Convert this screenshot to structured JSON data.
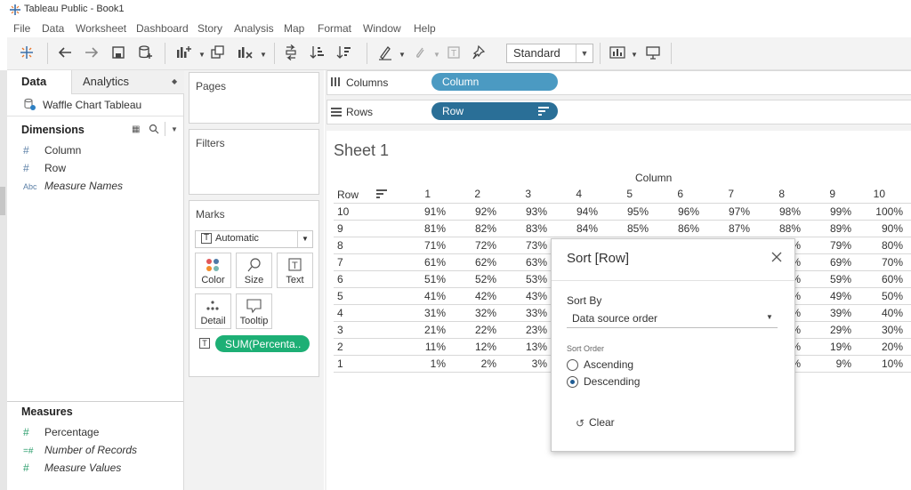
{
  "window": {
    "title": "Tableau Public - Book1"
  },
  "menu": [
    "File",
    "Data",
    "Worksheet",
    "Dashboard",
    "Story",
    "Analysis",
    "Map",
    "Format",
    "Window",
    "Help"
  ],
  "toolbar": {
    "fit_select": "Standard"
  },
  "data_pane": {
    "tabs": [
      "Data",
      "Analytics"
    ],
    "datasource": "Waffle Chart Tableau",
    "dimensions_header": "Dimensions",
    "dimensions": [
      {
        "icon": "#",
        "label": "Column"
      },
      {
        "icon": "#",
        "label": "Row"
      },
      {
        "icon": "Abc",
        "label": "Measure Names"
      }
    ],
    "measures_header": "Measures",
    "measures": [
      {
        "icon": "#",
        "label": "Percentage"
      },
      {
        "icon": "=#",
        "label": "Number of Records"
      },
      {
        "icon": "#",
        "label": "Measure Values"
      }
    ]
  },
  "cards": {
    "pages": "Pages",
    "filters": "Filters",
    "marks": "Marks",
    "mark_type": "Automatic",
    "mark_buttons": [
      "Color",
      "Size",
      "Text",
      "Detail",
      "Tooltip"
    ],
    "text_pill": "SUM(Percenta.."
  },
  "shelves": {
    "columns_label": "Columns",
    "columns_pill": "Column",
    "rows_label": "Rows",
    "rows_pill": "Row"
  },
  "sheet": {
    "title": "Sheet 1",
    "column_caption": "Column",
    "row_caption": "Row",
    "col_headers": [
      "1",
      "2",
      "3",
      "4",
      "5",
      "6",
      "7",
      "8",
      "9",
      "10"
    ],
    "rows": [
      {
        "label": "10",
        "cells": [
          "91%",
          "92%",
          "93%",
          "94%",
          "95%",
          "96%",
          "97%",
          "98%",
          "99%",
          "100%"
        ]
      },
      {
        "label": "9",
        "cells": [
          "81%",
          "82%",
          "83%",
          "84%",
          "85%",
          "86%",
          "87%",
          "88%",
          "89%",
          "90%"
        ]
      },
      {
        "label": "8",
        "cells": [
          "71%",
          "72%",
          "73%",
          "",
          "",
          "",
          "",
          "%",
          "79%",
          "80%"
        ]
      },
      {
        "label": "7",
        "cells": [
          "61%",
          "62%",
          "63%",
          "",
          "",
          "",
          "",
          "%",
          "69%",
          "70%"
        ]
      },
      {
        "label": "6",
        "cells": [
          "51%",
          "52%",
          "53%",
          "",
          "",
          "",
          "",
          "%",
          "59%",
          "60%"
        ]
      },
      {
        "label": "5",
        "cells": [
          "41%",
          "42%",
          "43%",
          "",
          "",
          "",
          "",
          "%",
          "49%",
          "50%"
        ]
      },
      {
        "label": "4",
        "cells": [
          "31%",
          "32%",
          "33%",
          "",
          "",
          "",
          "",
          "%",
          "39%",
          "40%"
        ]
      },
      {
        "label": "3",
        "cells": [
          "21%",
          "22%",
          "23%",
          "",
          "",
          "",
          "",
          "%",
          "29%",
          "30%"
        ]
      },
      {
        "label": "2",
        "cells": [
          "11%",
          "12%",
          "13%",
          "",
          "",
          "",
          "",
          "%",
          "19%",
          "20%"
        ]
      },
      {
        "label": "1",
        "cells": [
          "1%",
          "2%",
          "3%",
          "",
          "",
          "",
          "",
          "%",
          "9%",
          "10%"
        ]
      }
    ]
  },
  "dialog": {
    "title": "Sort [Row]",
    "sort_by_label": "Sort By",
    "sort_by_value": "Data source order",
    "sort_order_label": "Sort Order",
    "ascending": "Ascending",
    "descending": "Descending",
    "selected": "Descending",
    "clear": "Clear"
  }
}
